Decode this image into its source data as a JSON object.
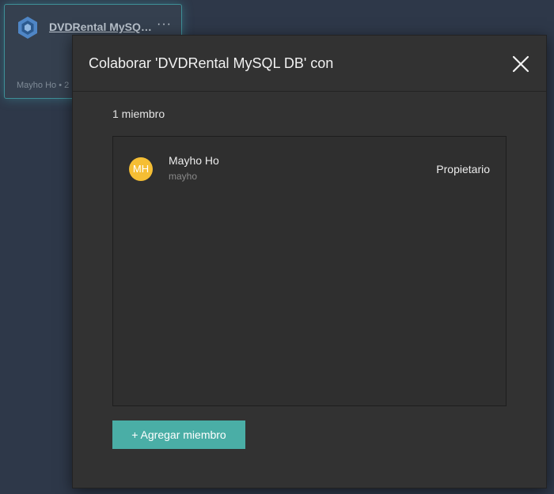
{
  "background_card": {
    "title": "DVDRental MySQL DB",
    "more_label": "···",
    "meta": "Mayho Ho • 2",
    "icon": "database-hexagon-icon"
  },
  "dialog": {
    "title": "Colaborar 'DVDRental MySQL DB' con",
    "close_icon": "close-icon",
    "member_count": "1 miembro",
    "members": [
      {
        "initials": "MH",
        "name": "Mayho Ho",
        "username": "mayho",
        "role": "Propietario",
        "avatar_color": "#f5be34"
      }
    ],
    "add_member_label": "+ Agregar miembro"
  },
  "colors": {
    "page_bg": "#2e3849",
    "dialog_bg": "#323232",
    "accent": "#4aaea6"
  }
}
